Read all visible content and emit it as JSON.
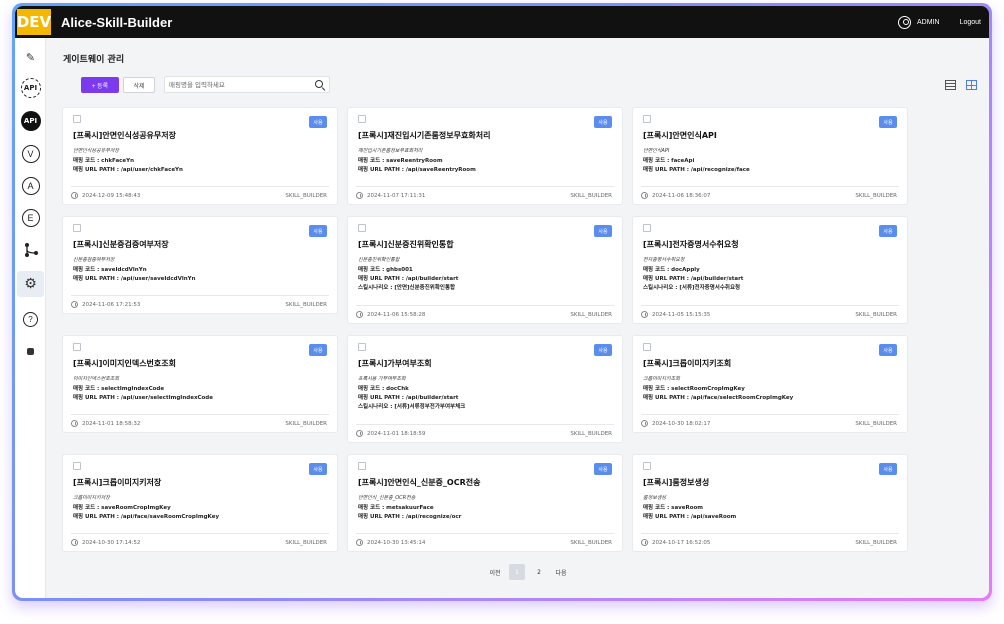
{
  "topbar": {
    "badge": "DEV",
    "title": "Alice-Skill-Builder",
    "user_name": "ADMIN",
    "logout_label": "Logout"
  },
  "sidebar": {
    "items": [
      {
        "icon": "pencil-icon",
        "label": "✎"
      },
      {
        "icon": "api-outline-icon",
        "label": "API"
      },
      {
        "icon": "api-solid-icon",
        "label": "API"
      },
      {
        "icon": "v-circle-icon",
        "label": "V"
      },
      {
        "icon": "a-circle-icon",
        "label": "A"
      },
      {
        "icon": "e-circle-icon",
        "label": "E"
      },
      {
        "icon": "flow-icon",
        "label": ""
      },
      {
        "icon": "gear-icon",
        "label": "⚙"
      },
      {
        "icon": "help-icon",
        "label": "?"
      },
      {
        "icon": "dot-icon",
        "label": ""
      }
    ]
  },
  "page": {
    "title": "게이트웨이 관리",
    "add_label": "+ 등록",
    "delete_label": "삭제",
    "search_placeholder": "매핑명을 입력하세요"
  },
  "cards": [
    {
      "badge": "사용",
      "title": "[프록시]안면인식성공유무저장",
      "sub": "안면인식성공유무저장",
      "lines": [
        "매핑 코드 : chkFaceYn",
        "매핑 URL PATH : /api/user/chkFaceYn"
      ],
      "date": "2024-12-09 15:48:43",
      "author": "SKILL_BUILDER"
    },
    {
      "badge": "사용",
      "title": "[프록시]재진입시기존룸정보무효화처리",
      "sub": "재진입시기존룸정보무효화처리",
      "lines": [
        "매핑 코드 : saveReentryRoom",
        "매핑 URL PATH : /api/saveReentryRoom"
      ],
      "date": "2024-11-07 17:11:31",
      "author": "SKILL_BUILDER"
    },
    {
      "badge": "사용",
      "title": "[프록시]안면인식API",
      "sub": "안면인식API",
      "lines": [
        "매핑 코드 : faceApi",
        "매핑 URL PATH : /api/recognize/face"
      ],
      "date": "2024-11-06 18:36:07",
      "author": "SKILL_BUILDER"
    },
    {
      "badge": "사용",
      "title": "[프록시]신분증검증여부저장",
      "sub": "신분증검증여부저장",
      "lines": [
        "매핑 코드 : saveIdcdVlnYn",
        "매핑 URL PATH : /api/user/saveIdcdVlnYn"
      ],
      "date": "2024-11-06 17:21:53",
      "author": "SKILL_BUILDER"
    },
    {
      "badge": "사용",
      "title": "[프록시]신분증진위확인통합",
      "sub": "신분증진위확인통합",
      "lines": [
        "매핑 코드 : ghbs001",
        "매핑 URL PATH : /api/builder/start",
        "스킬시나리오 : [안면]신분증진위확인통합"
      ],
      "date": "2024-11-06 15:58:28",
      "author": "SKILL_BUILDER"
    },
    {
      "badge": "사용",
      "title": "[프록시]전자증명서수취요청",
      "sub": "전자증명서수취요청",
      "lines": [
        "매핑 코드 : docApply",
        "매핑 URL PATH : /api/builder/start",
        "스킬시나리오 : [서류]전자증명서수취요청"
      ],
      "date": "2024-11-05 15:15:35",
      "author": "SKILL_BUILDER"
    },
    {
      "badge": "사용",
      "title": "[프록시]이미지인덱스번호조회",
      "sub": "이미지인덱스번호조회",
      "lines": [
        "매핑 코드 : selectImgIndexCode",
        "매핑 URL PATH : /api/user/selectImgIndexCode"
      ],
      "date": "2024-11-01 18:58:32",
      "author": "SKILL_BUILDER"
    },
    {
      "badge": "사용",
      "title": "[프록시]가부여부조회",
      "sub": "프록시용 가부여부조회",
      "lines": [
        "매핑 코드 : docChk",
        "매핑 URL PATH : /api/builder/start",
        "스킬시나리오 : [서류]서류정부전가부여부체크"
      ],
      "date": "2024-11-01 18:18:59",
      "author": "SKILL_BUILDER"
    },
    {
      "badge": "사용",
      "title": "[프록시]크롭이미지키조회",
      "sub": "크롭이미지키조회",
      "lines": [
        "매핑 코드 : selectRoomCropImgKey",
        "매핑 URL PATH : /api/face/selectRoomCropImgKey"
      ],
      "date": "2024-10-30 18:02:17",
      "author": "SKILL_BUILDER"
    },
    {
      "badge": "사용",
      "title": "[프록시]크롭이미지키저장",
      "sub": "크롭이미지키저장",
      "lines": [
        "매핑 코드 : saveRoomCropImgKey",
        "매핑 URL PATH : /api/face/saveRoomCropImgKey"
      ],
      "date": "2024-10-30 17:14:52",
      "author": "SKILL_BUILDER"
    },
    {
      "badge": "사용",
      "title": "[프록시]안면인식_신분증_OCR전송",
      "sub": "안면인식_신분증_OCR전송",
      "lines": [
        "매핑 코드 : metsakuurFace",
        "매핑 URL PATH : /api/recognize/ocr"
      ],
      "date": "2024-10-30 13:45:14",
      "author": "SKILL_BUILDER"
    },
    {
      "badge": "사용",
      "title": "[프록시]룸정보생성",
      "sub": "룸정보생성",
      "lines": [
        "매핑 코드 : saveRoom",
        "매핑 URL PATH : /api/saveRoom"
      ],
      "date": "2024-10-17 16:52:05",
      "author": "SKILL_BUILDER"
    }
  ],
  "pagination": {
    "prev_label": "이전",
    "pages": [
      "1",
      "2"
    ],
    "next_label": "다음"
  }
}
